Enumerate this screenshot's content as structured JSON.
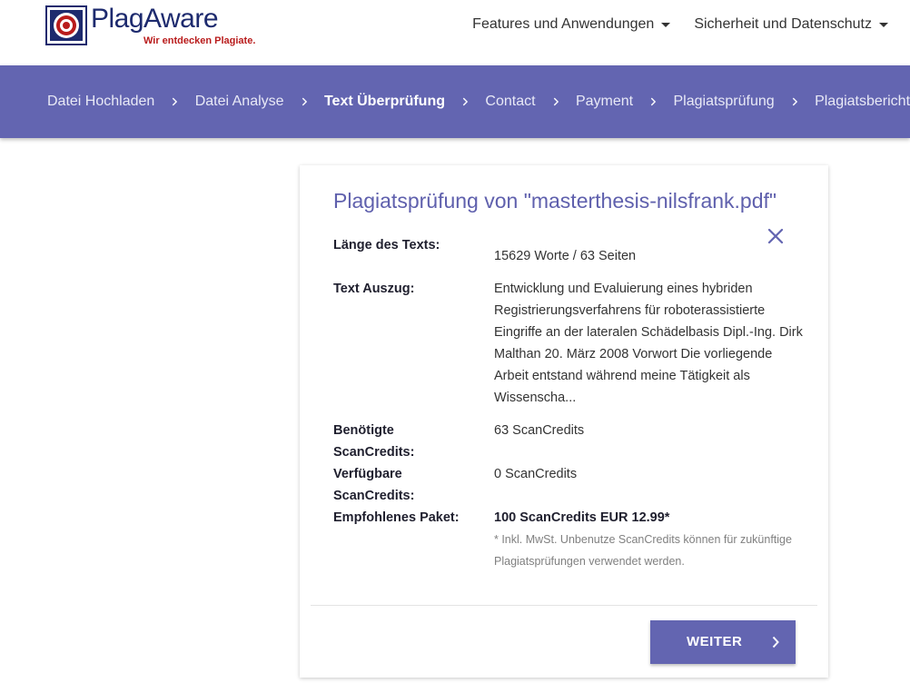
{
  "header": {
    "logo": {
      "name": "PlagAware",
      "tagline": "Wir entdecken Plagiate."
    },
    "nav": [
      {
        "label": "Features und Anwendungen"
      },
      {
        "label": "Sicherheit und Datenschutz"
      }
    ]
  },
  "stepper": {
    "steps": [
      {
        "label": "Datei Hochladen"
      },
      {
        "label": "Datei Analyse"
      },
      {
        "label": "Text Überprüfung",
        "active": true
      },
      {
        "label": "Contact"
      },
      {
        "label": "Payment"
      },
      {
        "label": "Plagiatsprüfung"
      },
      {
        "label": "Plagiatsbericht"
      }
    ]
  },
  "card": {
    "title": "Plagiatsprüfung von \"masterthesis-nilsfrank.pdf\"",
    "rows": {
      "text_length": {
        "label": "Länge des Texts:",
        "value": "15629 Worte / 63 Seiten"
      },
      "excerpt": {
        "label": "Text Auszug:",
        "value": "Entwicklung und Evaluierung eines hybriden Registrierungsverfahrens für roboterassistierte Eingriffe an der lateralen Schädelbasis Dipl.-Ing. Dirk Malthan 20. März 2008 Vorwort Die vorliegende Arbeit entstand während meine Tätigkeit als Wissenscha..."
      },
      "required": {
        "label": "Benötigte ScanCredits:",
        "value": "63 ScanCredits"
      },
      "available": {
        "label": "Verfügbare ScanCredits:",
        "value": "0 ScanCredits"
      },
      "package": {
        "label": "Empfohlenes Paket:",
        "value": "100 ScanCredits EUR 12.99*"
      }
    },
    "footnote": "* Inkl. MwSt. Unbenutze ScanCredits können für zukünftige Plagiatsprüfungen verwendet werden.",
    "next_button": "WEITER"
  },
  "colors": {
    "primary": "#6365b1",
    "logo_navy": "#1d2a6e",
    "logo_red": "#b91c1c"
  },
  "icons": {
    "close": "close-icon",
    "step_separator": "chevron-right-icon",
    "nav_dropdown": "caret-down-icon",
    "button_chevron": "chevron-right-icon"
  }
}
